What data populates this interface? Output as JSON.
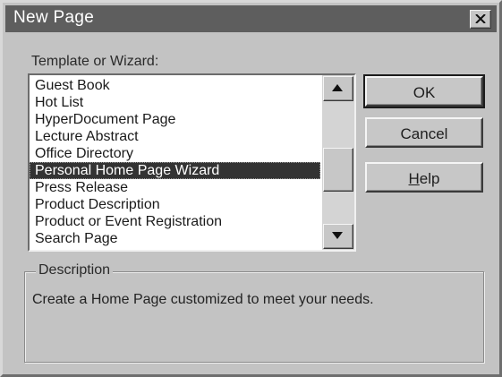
{
  "window": {
    "title": "New Page",
    "close_icon": "close-x-icon"
  },
  "template_label": "Template or Wizard:",
  "templates": [
    "Guest Book",
    "Hot List",
    "HyperDocument Page",
    "Lecture Abstract",
    "Office Directory",
    "Personal Home Page Wizard",
    "Press Release",
    "Product Description",
    "Product or Event Registration",
    "Search Page"
  ],
  "selected_template": "Personal Home Page Wizard",
  "scrollbar": {
    "up_icon": "arrow-up-icon",
    "down_icon": "arrow-down-icon"
  },
  "buttons": {
    "ok": "OK",
    "cancel": "Cancel",
    "help_mnemonic": "H",
    "help_rest": "elp"
  },
  "description_group": {
    "title": "Description",
    "text": "Create a Home Page customized to meet your needs."
  }
}
